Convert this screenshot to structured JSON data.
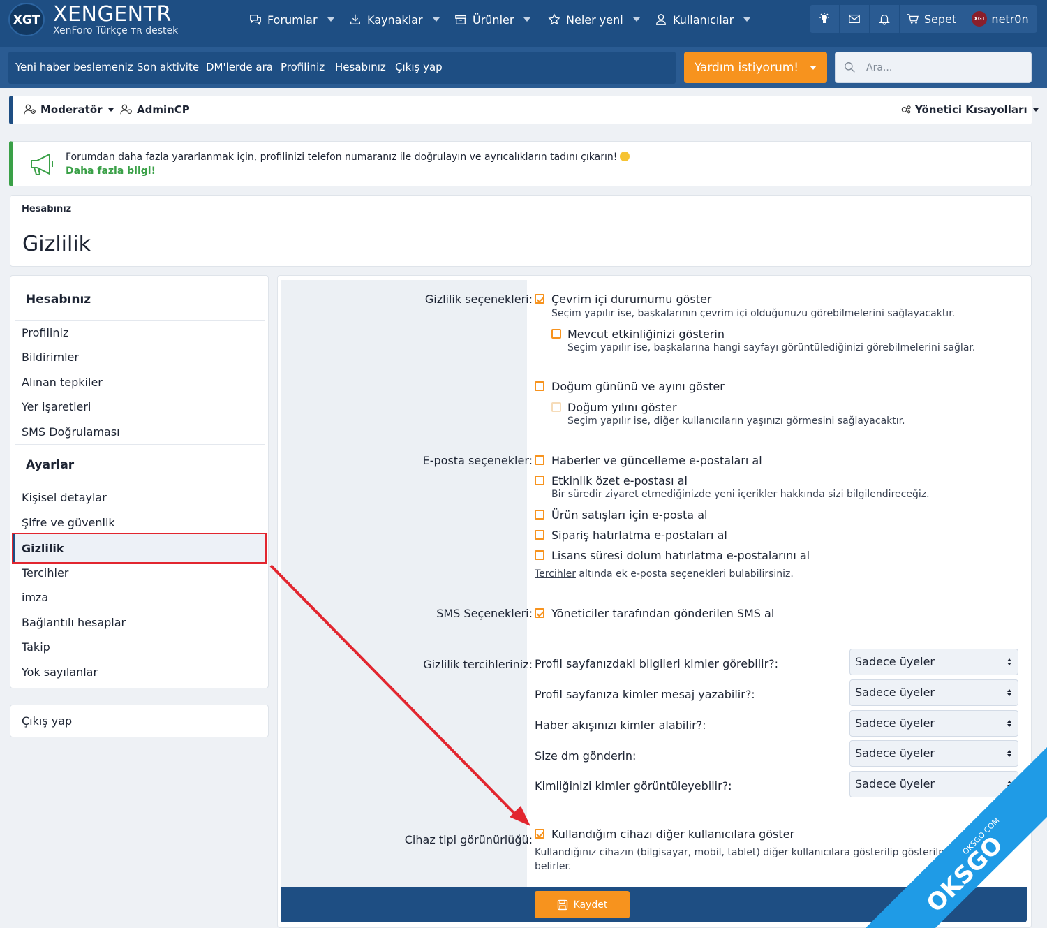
{
  "brand": {
    "logo": "XGT",
    "name": "XENGENTR",
    "tagline": "XenForo Türkçe ᴛʀ destek"
  },
  "nav": [
    {
      "label": "Forumlar",
      "icon": "comments-icon"
    },
    {
      "label": "Kaynaklar",
      "icon": "download-icon"
    },
    {
      "label": "Ürünler",
      "icon": "box-icon"
    },
    {
      "label": "Neler yeni",
      "icon": "star-icon"
    },
    {
      "label": "Kullanıcılar",
      "icon": "user-icon"
    }
  ],
  "topright": {
    "cart": "Sepet",
    "user": "netr0n",
    "user_badge": "XGT"
  },
  "subnav": [
    "Yeni haber beslemeniz",
    "Son aktivite",
    "DM'lerde ara",
    "Profiliniz",
    "Hesabınız",
    "Çıkış yap"
  ],
  "help": "Yardım istiyorum!",
  "search": {
    "placeholder": "Ara..."
  },
  "modbar": {
    "moderator": "Moderatör",
    "admincp": "AdminCP",
    "shortcuts": "Yönetici Kısayolları"
  },
  "notice": {
    "text": "Forumdan daha fazla yararlanmak için, profilinizi telefon numaranız ile doğrulayın ve ayrıcalıkların tadını çıkarın!",
    "link": "Daha fazla bilgi!"
  },
  "breadcrumb": "Hesabınız",
  "page_title": "Gizlilik",
  "sidebar": {
    "section1": "Hesabınız",
    "items1": [
      "Profiliniz",
      "Bildirimler",
      "Alınan tepkiler",
      "Yer işaretleri",
      "SMS Doğrulaması"
    ],
    "section2": "Ayarlar",
    "items2": [
      "Kişisel detaylar",
      "Şifre ve güvenlik",
      "Gizlilik",
      "Tercihler",
      "imza",
      "Bağlantılı hesaplar",
      "Takip",
      "Yok sayılanlar"
    ],
    "logout": "Çıkış yap"
  },
  "form": {
    "privacy_label": "Gizlilik seçenekleri:",
    "online": {
      "label": "Çevrim içi durumumu göster",
      "hint": "Seçim yapılır ise, başkalarının çevrim içi olduğunuzu görebilmelerini sağlayacaktır.",
      "checked": true
    },
    "activity": {
      "label": "Mevcut etkinliğinizi gösterin",
      "hint": "Seçim yapılır ise, başkalarına hangi sayfayı görüntülediğinizi görebilmelerini sağlar.",
      "checked": false
    },
    "birthday": {
      "label": "Doğum gününü ve ayını göster",
      "checked": false
    },
    "birthyear": {
      "label": "Doğum yılını göster",
      "hint": "Seçim yapılır ise, diğer kullanıcıların yaşınızı görmesini sağlayacaktır.",
      "checked": false
    },
    "email_label": "E-posta seçenekler:",
    "email_opts": [
      {
        "label": "Haberler ve güncelleme e-postaları al",
        "checked": false
      },
      {
        "label": "Etkinlik özet e-postası al",
        "checked": false
      },
      {
        "label": "Ürün satışları için e-posta al",
        "checked": false
      },
      {
        "label": "Sipariş hatırlatma e-postaları al",
        "checked": false
      },
      {
        "label": "Lisans süresi dolum hatırlatma e-postalarını al",
        "checked": false
      }
    ],
    "digest_hint": "Bir süredir ziyaret etmediğinizde yeni içerikler hakkında sizi bilgilendireceğiz.",
    "email_more_link": "Tercihler",
    "email_more_text": " altında ek e-posta seçenekleri bulabilirsiniz.",
    "sms_label": "SMS Seçenekleri:",
    "sms_opt": {
      "label": "Yöneticiler tarafından gönderilen SMS al",
      "checked": true
    },
    "pref_label": "Gizlilik tercihleriniz:",
    "prefs": [
      {
        "label": "Profil sayfanızdaki bilgileri kimler görebilir?:",
        "value": "Sadece üyeler"
      },
      {
        "label": "Profil sayfanıza kimler mesaj yazabilir?:",
        "value": "Sadece üyeler"
      },
      {
        "label": "Haber akışınızı kimler alabilir?:",
        "value": "Sadece üyeler"
      },
      {
        "label": "Size dm gönderin:",
        "value": "Sadece üyeler"
      },
      {
        "label": "Kimliğinizi kimler görüntüleyebilir?:",
        "value": "Sadece üyeler"
      }
    ],
    "device_label": "Cihaz tipi görünürlüğü:",
    "device_opt": {
      "label": "Kullandığım cihazı diğer kullanıcılara göster",
      "checked": true
    },
    "device_hint1": "Kullandığınız cihazın (bilgisayar, mobil, tablet) diğer kullanıcılara gösterilip gösterilmeyeceğini",
    "device_hint2": "belirler.",
    "save": "Kaydet"
  },
  "watermark": {
    "big": "OKSGO",
    "small": "OKSGO.COM"
  },
  "colors": {
    "primary": "#1e4e83",
    "accent": "#f7931e",
    "success": "#3aa047",
    "highlight": "#e2262f"
  }
}
